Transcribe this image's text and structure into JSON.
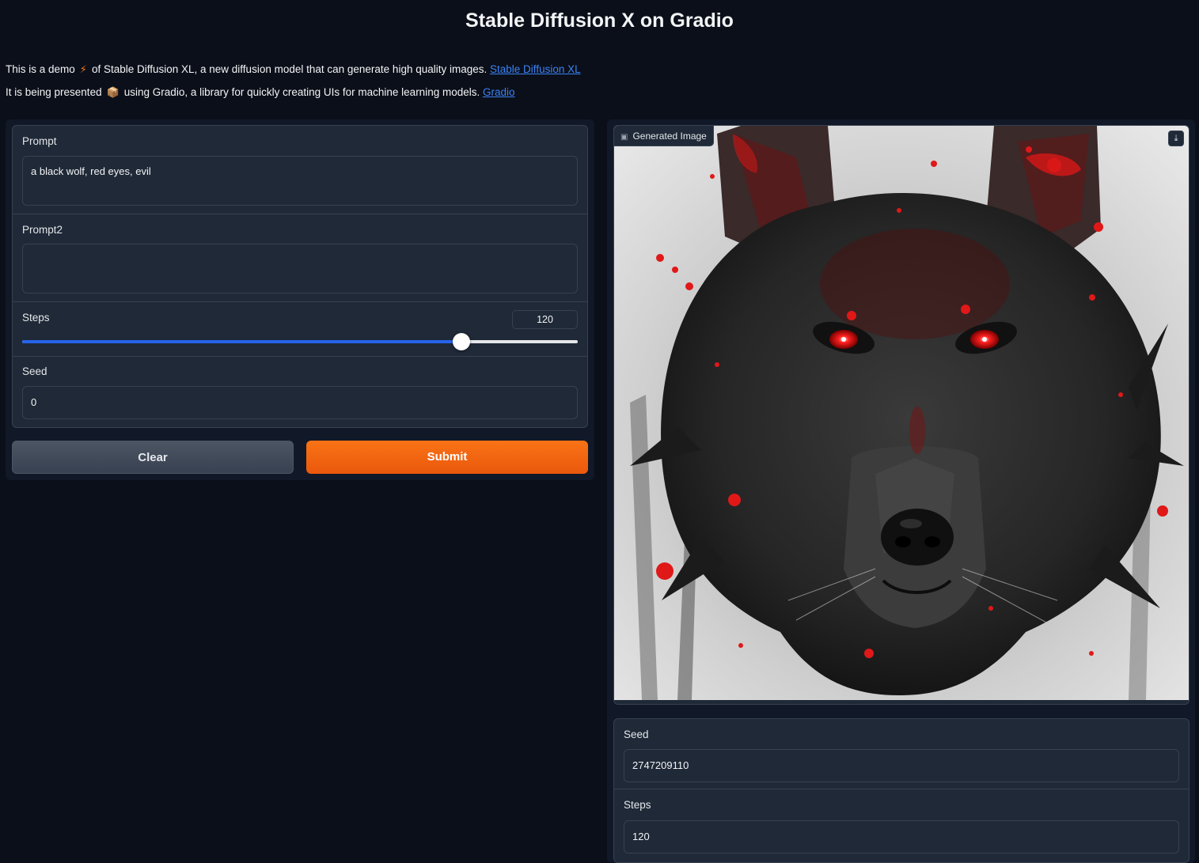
{
  "header": {
    "title": "Stable Diffusion X on Gradio",
    "line1_a": "This is a demo",
    "line1_b": "of Stable Diffusion XL, a new diffusion model that can generate high quality images.",
    "line1_link": "Stable Diffusion XL",
    "line2_a": "It is being presented",
    "line2_b": "using Gradio, a library for quickly creating UIs for machine learning models.",
    "line2_link": "Gradio"
  },
  "inputs": {
    "prompt_label": "Prompt",
    "prompt_value": "a black wolf, red eyes, evil",
    "prompt2_label": "Prompt2",
    "prompt2_value": "",
    "steps_label": "Steps",
    "steps_value": "120",
    "steps_fraction": 0.79,
    "seed_label": "Seed",
    "seed_value": "0"
  },
  "buttons": {
    "clear": "Clear",
    "submit": "Submit"
  },
  "output": {
    "image_label": "Generated Image",
    "seed_label": "Seed",
    "seed_value": "2747209110",
    "steps_label": "Steps",
    "steps_value": "120"
  },
  "colors": {
    "background": "#0b0f19",
    "panel": "#1f2937",
    "accent_orange": "#f97316",
    "slider_blue": "#2563eb",
    "link_blue": "#3b82f6"
  },
  "icons": {
    "bolt": "lightning-icon",
    "package": "package-icon",
    "image": "image-icon",
    "download": "download-icon"
  }
}
